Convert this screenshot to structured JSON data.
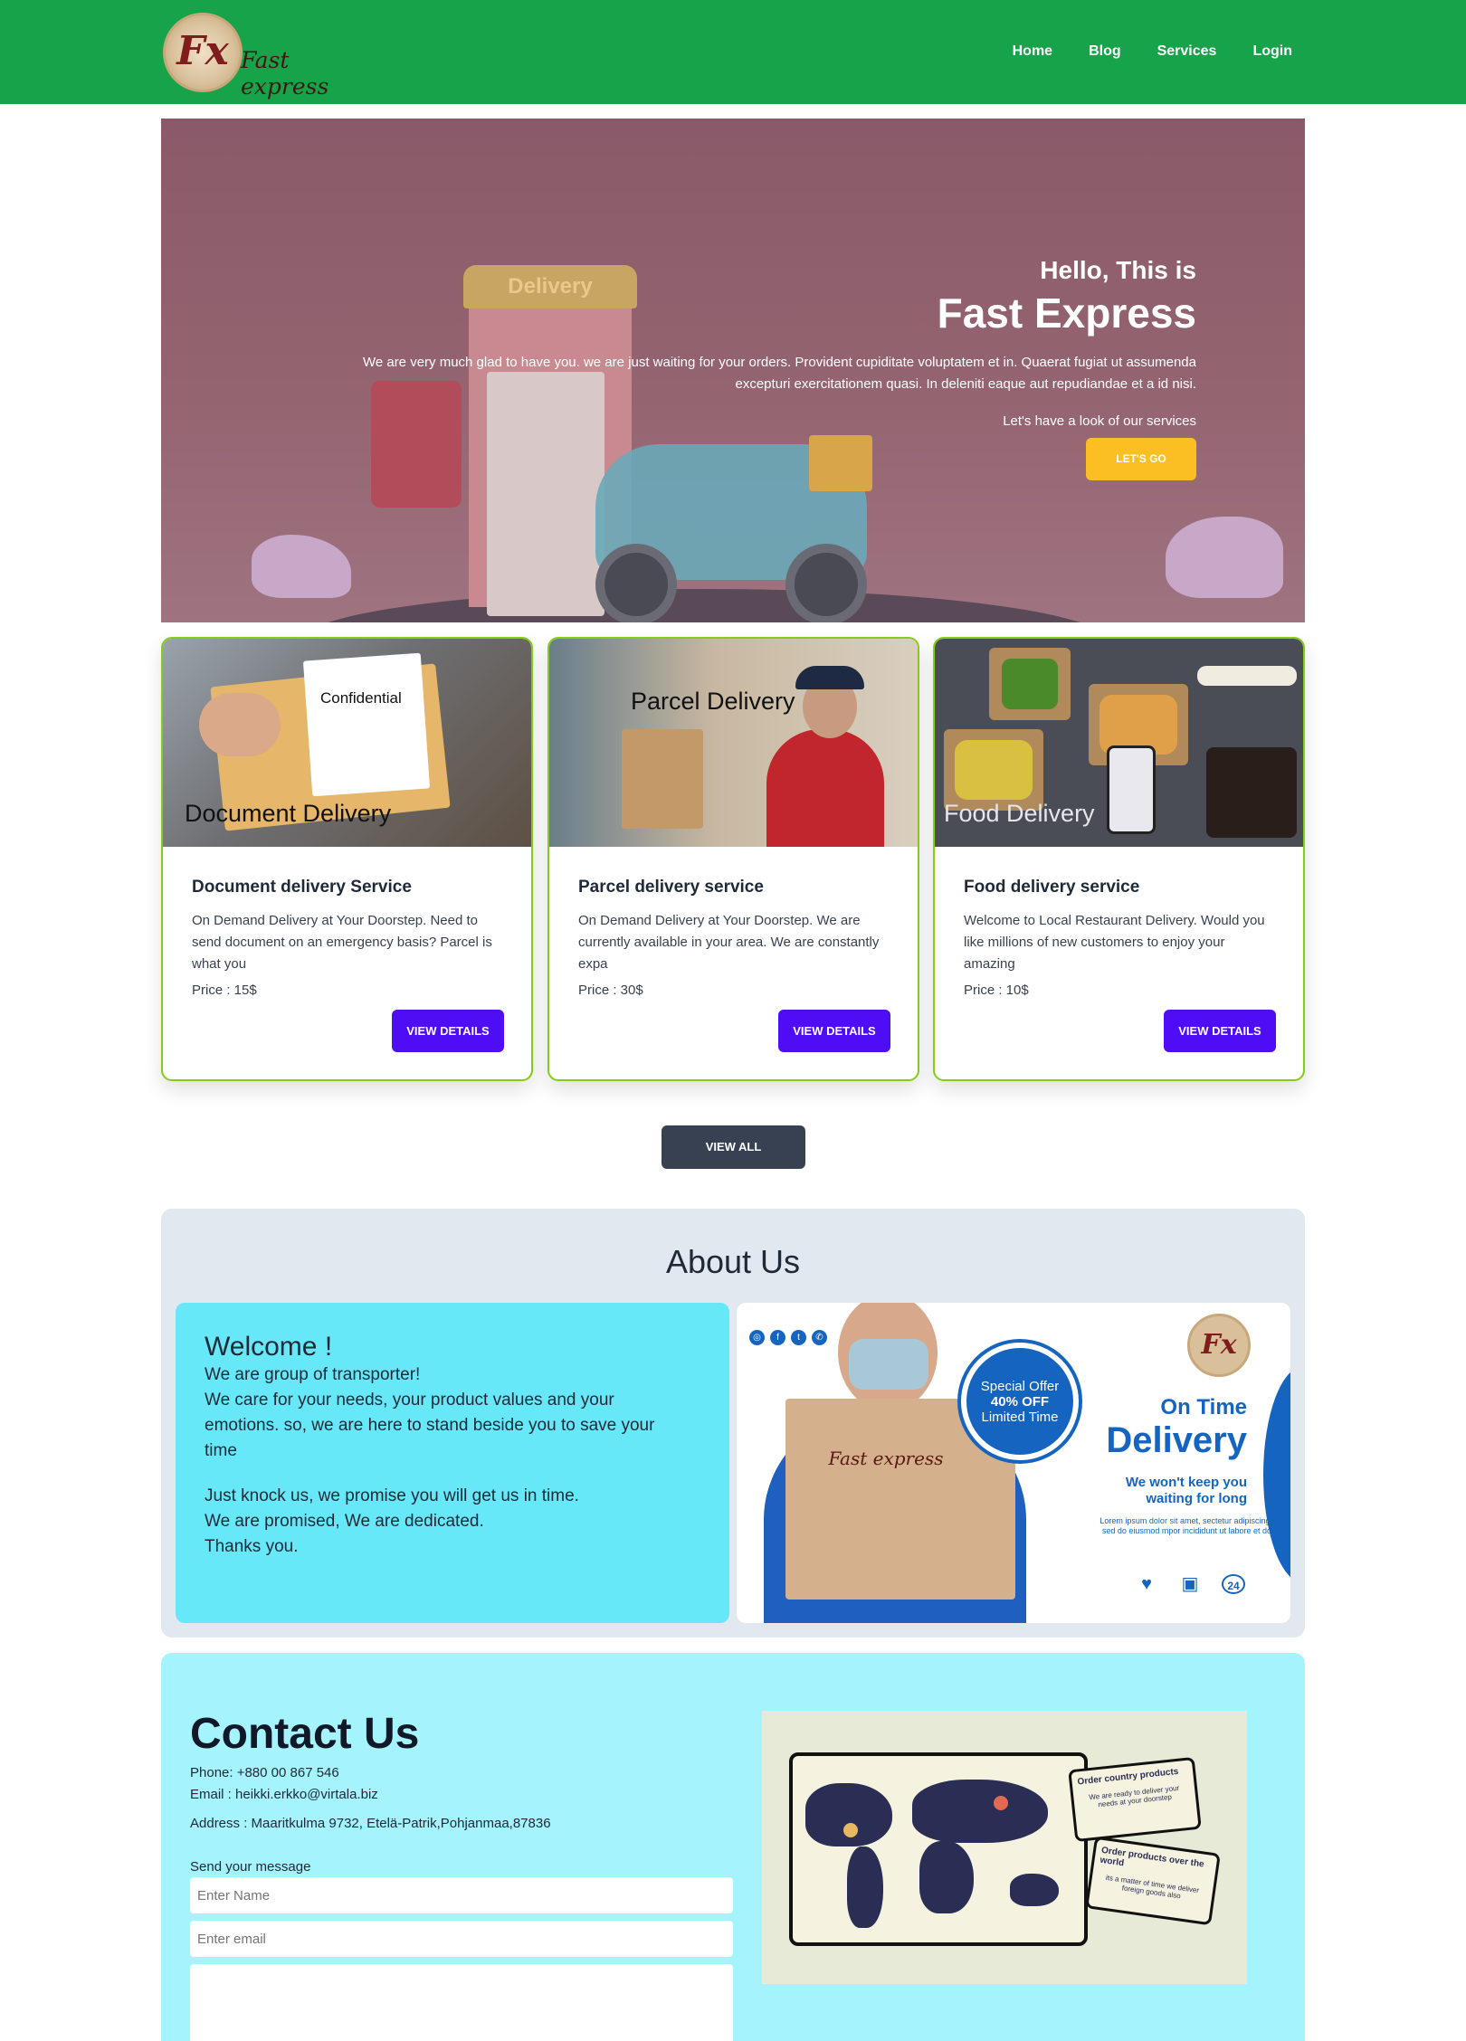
{
  "nav": {
    "brand": "Fast express",
    "logo_mark": "Fx",
    "links": [
      "Home",
      "Blog",
      "Services",
      "Login"
    ]
  },
  "hero": {
    "sign": "Delivery",
    "greeting": "Hello, This is",
    "title": "Fast Express",
    "description_line1": "We are very much glad to have you. we are just waiting for your orders. Provident cupiditate voluptatem et in. Quaerat fugiat ut assumenda",
    "description_line2": "excepturi exercitationem quasi. In deleniti eaque aut repudiandae et a id nisi.",
    "cta_text": "Let's have a look of our services",
    "button": "LET'S GO"
  },
  "services": [
    {
      "image_label": "Document Delivery",
      "image_tag": "Confidential",
      "title": "Document delivery Service",
      "description": "On Demand Delivery at Your Doorstep. Need to send document on an emergency basis? Parcel is what you",
      "price": "Price : 15$",
      "button": "VIEW DETAILS"
    },
    {
      "image_label": "Parcel Delivery",
      "title": "Parcel delivery service",
      "description": "On Demand Delivery at Your Doorstep. We are currently available in your area. We are constantly expa",
      "price": "Price : 30$",
      "button": "VIEW DETAILS"
    },
    {
      "image_label": "Food Delivery",
      "title": "Food delivery service",
      "description": "Welcome to Local Restaurant Delivery. Would you like millions of new customers to enjoy your amazing",
      "price": "Price : 10$",
      "button": "VIEW DETAILS"
    }
  ],
  "view_all": "VIEW ALL",
  "about": {
    "title": "About Us",
    "welcome": "Welcome !",
    "para1": [
      "We are group of transporter!",
      "We care for your needs, your product values and your",
      "emotions. so, we are here to stand beside you to save your",
      "time"
    ],
    "para2": [
      "Just knock us, we promise you will get us in time.",
      "We are promised, We are dedicated.",
      "Thanks you."
    ],
    "promo": {
      "brand": "Fast express",
      "logo_mark": "Fx",
      "offer_line1": "Special Offer",
      "offer_line2": "40% OFF",
      "offer_line3": "Limited Time",
      "heading_small": "On Time",
      "heading_big": "Delivery",
      "tagline1": "We won't keep you",
      "tagline2": "waiting for long",
      "lorem": "Lorem ipsum dolor sit amet, sectetur adipiscing elit, sed do eiusmod mpor incididunt ut labore et dolore",
      "social_icons": [
        "instagram-icon",
        "facebook-icon",
        "twitter-icon",
        "whatsapp-icon"
      ],
      "feature_icons": [
        "hand-heart-icon",
        "truck-icon",
        "support-24-icon"
      ],
      "feature_label": "24"
    }
  },
  "contact": {
    "title": "Contact Us",
    "phone": "Phone: +880 00 867 546",
    "email": "Email : heikki.erkko@virtala.biz",
    "address": "Address : Maaritkulma 9732, Etelä-Patrik,Pohjanmaa,87836",
    "form_label": "Send your message",
    "name_placeholder": "Enter Name",
    "email_placeholder": "Enter email",
    "map_note1_title": "Order country products",
    "map_note1_sub": "We are ready to deliver your needs at your doorstep",
    "map_note2_title": "Order products over the world",
    "map_note2_sub": "its a matter of time we deliver foreign goods also"
  },
  "colors": {
    "nav_bg": "#16a34a",
    "accent_yellow": "#fbbf24",
    "details_button": "#4f0df5",
    "card_border": "#84cc16",
    "about_bg": "#e2e8f0",
    "about_panel": "#67e8f9",
    "contact_bg": "#a5f3fc"
  }
}
